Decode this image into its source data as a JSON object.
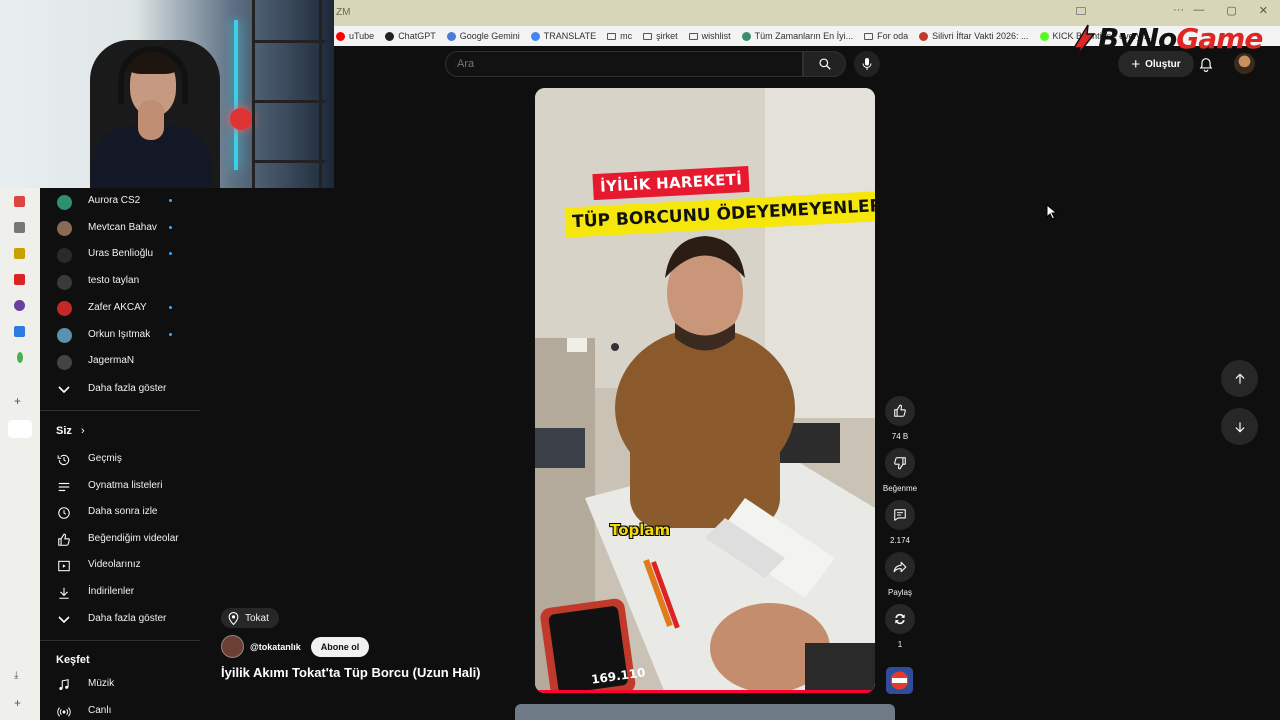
{
  "browser": {
    "tab_title_fragment": "ZM",
    "window_controls": [
      "—",
      "▢",
      "✕"
    ],
    "bookmarks": [
      {
        "label": "uTube",
        "icon": "youtube-icon",
        "color": "#ff0000"
      },
      {
        "label": "ChatGPT",
        "icon": "chatgpt-icon",
        "color": "#222222"
      },
      {
        "label": "Google Gemini",
        "icon": "gemini-icon",
        "color": "#4a7bd8"
      },
      {
        "label": "TRANSLATE",
        "icon": "translate-icon",
        "color": "#4285f4"
      },
      {
        "label": "mc",
        "icon": "folder-icon",
        "color": "#555555"
      },
      {
        "label": "şirket",
        "icon": "folder-icon",
        "color": "#555555"
      },
      {
        "label": "wishlist",
        "icon": "folder-icon",
        "color": "#555555"
      },
      {
        "label": "Tüm Zamanların En İyi...",
        "icon": "globe-icon",
        "color": "#3a8f6a"
      },
      {
        "label": "For oda",
        "icon": "folder-icon",
        "color": "#555555"
      },
      {
        "label": "Silivri İftar Vakti 2026: ...",
        "icon": "page-icon",
        "color": "#c0392b"
      },
      {
        "label": "KICK Bounties - every ...",
        "icon": "kick-icon",
        "color": "#53fc18"
      }
    ]
  },
  "header": {
    "search_placeholder": "Ara",
    "create_label": "Oluştur"
  },
  "sidebar": {
    "subscriptions": [
      {
        "label": "Aurora CS2",
        "avatar_color": "#2f8f6f",
        "dot": true
      },
      {
        "label": "Mevtcan Bahav",
        "avatar_color": "#8a6a55",
        "dot": true
      },
      {
        "label": "Uras Benlioğlu",
        "avatar_color": "#2a2a2a",
        "dot": true
      },
      {
        "label": "testo taylan",
        "avatar_color": "#3a3a3a",
        "dot": false
      },
      {
        "label": "Zafer AKCAY",
        "avatar_color": "#c62828",
        "dot": true
      },
      {
        "label": "Orkun Işıtmak",
        "avatar_color": "#5d8fb0",
        "dot": true
      },
      {
        "label": "JagermaN",
        "avatar_color": "#444444",
        "dot": false
      }
    ],
    "show_more_1": "Daha fazla göster",
    "you_heading": "Siz",
    "you_items": [
      {
        "label": "Geçmiş",
        "icon": "history-icon"
      },
      {
        "label": "Oynatma listeleri",
        "icon": "playlists-icon"
      },
      {
        "label": "Daha sonra izle",
        "icon": "watch-later-icon"
      },
      {
        "label": "Beğendiğim videolar",
        "icon": "liked-icon"
      },
      {
        "label": "Videolarınız",
        "icon": "your-videos-icon"
      },
      {
        "label": "İndirilenler",
        "icon": "downloads-icon"
      }
    ],
    "show_more_2": "Daha fazla göster",
    "explore_heading": "Keşfet",
    "explore_items": [
      {
        "label": "Müzik",
        "icon": "music-icon"
      },
      {
        "label": "Canlı",
        "icon": "live-icon"
      }
    ]
  },
  "short": {
    "banner_red": "İYİLİK HAREKETİ",
    "banner_yellow": "TÜP BORCUNU ÖDEYEMEYENLERİN GÜNÜ",
    "subtitle_word": "Toplam",
    "phone_reading": "169.110",
    "location": "Tokat",
    "channel_handle": "@tokatanlık",
    "subscribe_label": "Abone ol",
    "title": "İyilik Akımı Tokat'ta Tüp Borcu (Uzun Hali)",
    "likes": "74 B",
    "dislike_label": "Beğenme",
    "comments": "2.174",
    "share_label": "Paylaş",
    "remix_count": "1",
    "accent_color": "#ff0033"
  },
  "watermark": {
    "part1": "ByNo",
    "part2": "Game"
  }
}
